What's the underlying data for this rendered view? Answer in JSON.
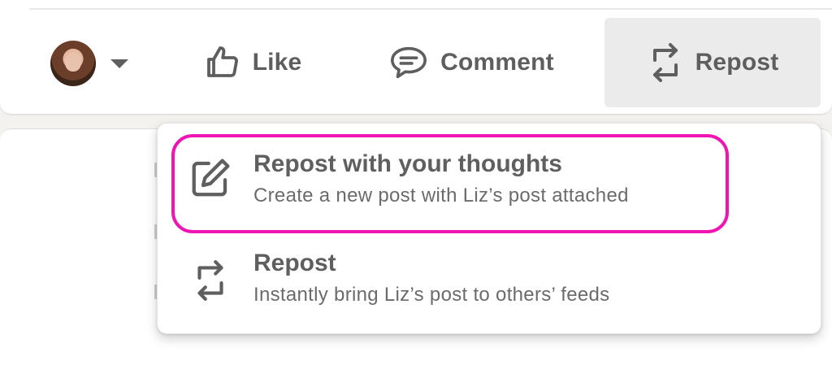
{
  "action_bar": {
    "like_label": "Like",
    "comment_label": "Comment",
    "repost_label": "Repost"
  },
  "repost_menu": {
    "items": [
      {
        "title": "Repost with your thoughts",
        "subtitle": "Create a new post with Liz’s post attached",
        "icon": "edit-icon",
        "highlighted": true
      },
      {
        "title": "Repost",
        "subtitle": "Instantly bring Liz’s post to others’ feeds",
        "icon": "repost-icon",
        "highlighted": false
      }
    ]
  },
  "colors": {
    "highlight": "#f015b3",
    "text_primary": "#5f5f5f",
    "active_button_bg": "#ebebeb"
  }
}
